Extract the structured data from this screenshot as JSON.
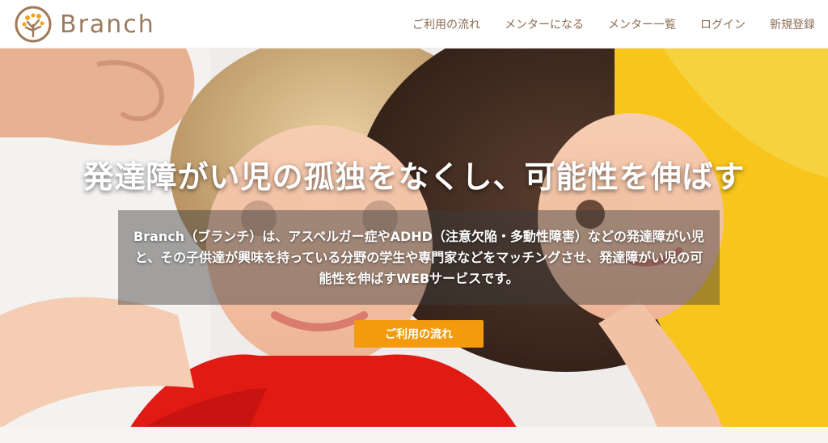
{
  "brand": {
    "name": "Branch",
    "logo_icon": "tree-icon"
  },
  "nav": {
    "items": [
      {
        "label": "ご利用の流れ"
      },
      {
        "label": "メンターになる"
      },
      {
        "label": "メンター一覧"
      },
      {
        "label": "ログイン"
      },
      {
        "label": "新規登録"
      }
    ]
  },
  "hero": {
    "headline": "発達障がい児の孤独をなくし、可能性を伸ばす",
    "description": "Branch（ブランチ）は、アスペルガー症やADHD（注意欠陥・多動性障害）などの発達障がい児と、その子供達が興味を持っている分野の学生や専門家などをマッチングさせ、発達障がい児の可能性を伸ばすWEBサービスです。",
    "cta_label": "ご利用の流れ",
    "background": "children-playing-photo"
  },
  "colors": {
    "brand_text": "#9a7b5e",
    "nav_text": "#8a6c51",
    "accent": "#f39a0e"
  }
}
